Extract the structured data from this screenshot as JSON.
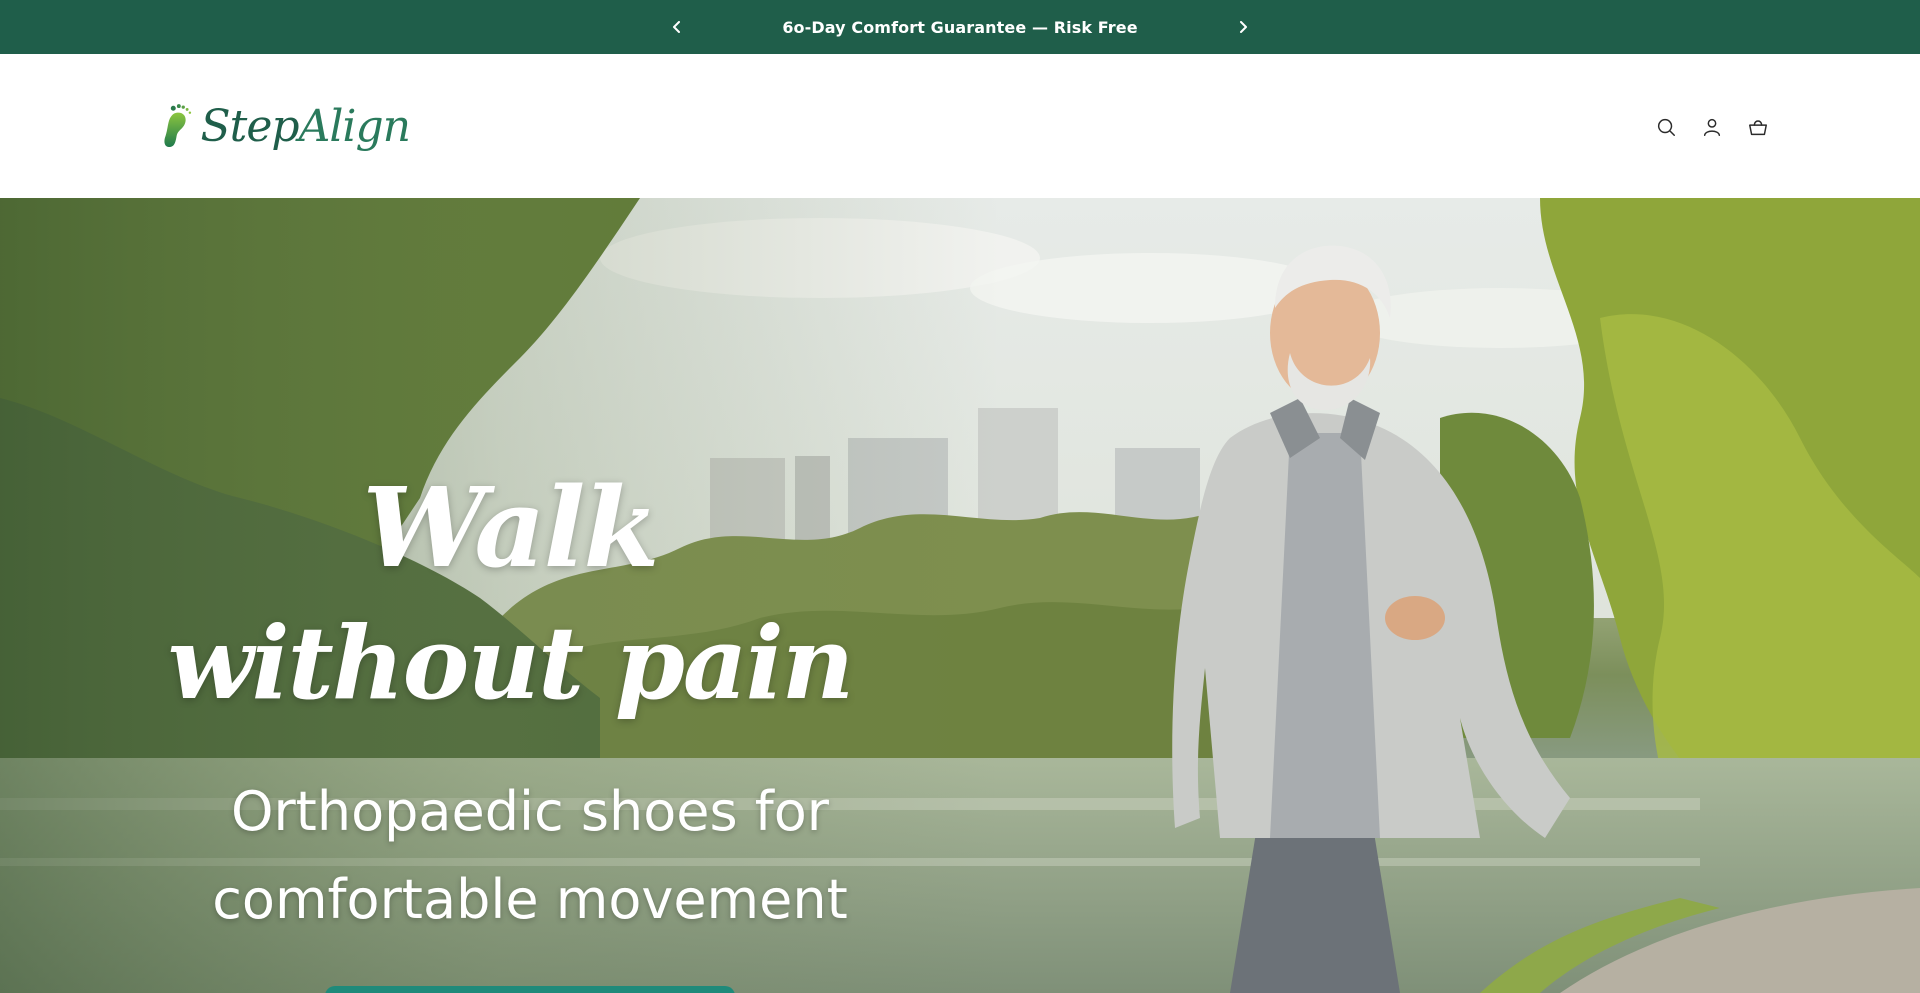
{
  "announcement": {
    "message": "6o-Day Comfort Guarantee — Risk Free",
    "prev_icon": "chevron-left-icon",
    "next_icon": "chevron-right-icon",
    "background": "#1f5e4a"
  },
  "header": {
    "logo": {
      "text_part1": "Step",
      "text_part2": "Align",
      "icon": "footprint-icon",
      "color": "#1f5e4a"
    },
    "icons": [
      "search-icon",
      "account-icon",
      "cart-icon"
    ]
  },
  "hero": {
    "title_line1": "Walk",
    "title_line2": "without pain",
    "subtitle_line1": "Orthopaedic shoes for",
    "subtitle_line2": "comfortable movement",
    "cta_color": "#1f8a7a"
  }
}
